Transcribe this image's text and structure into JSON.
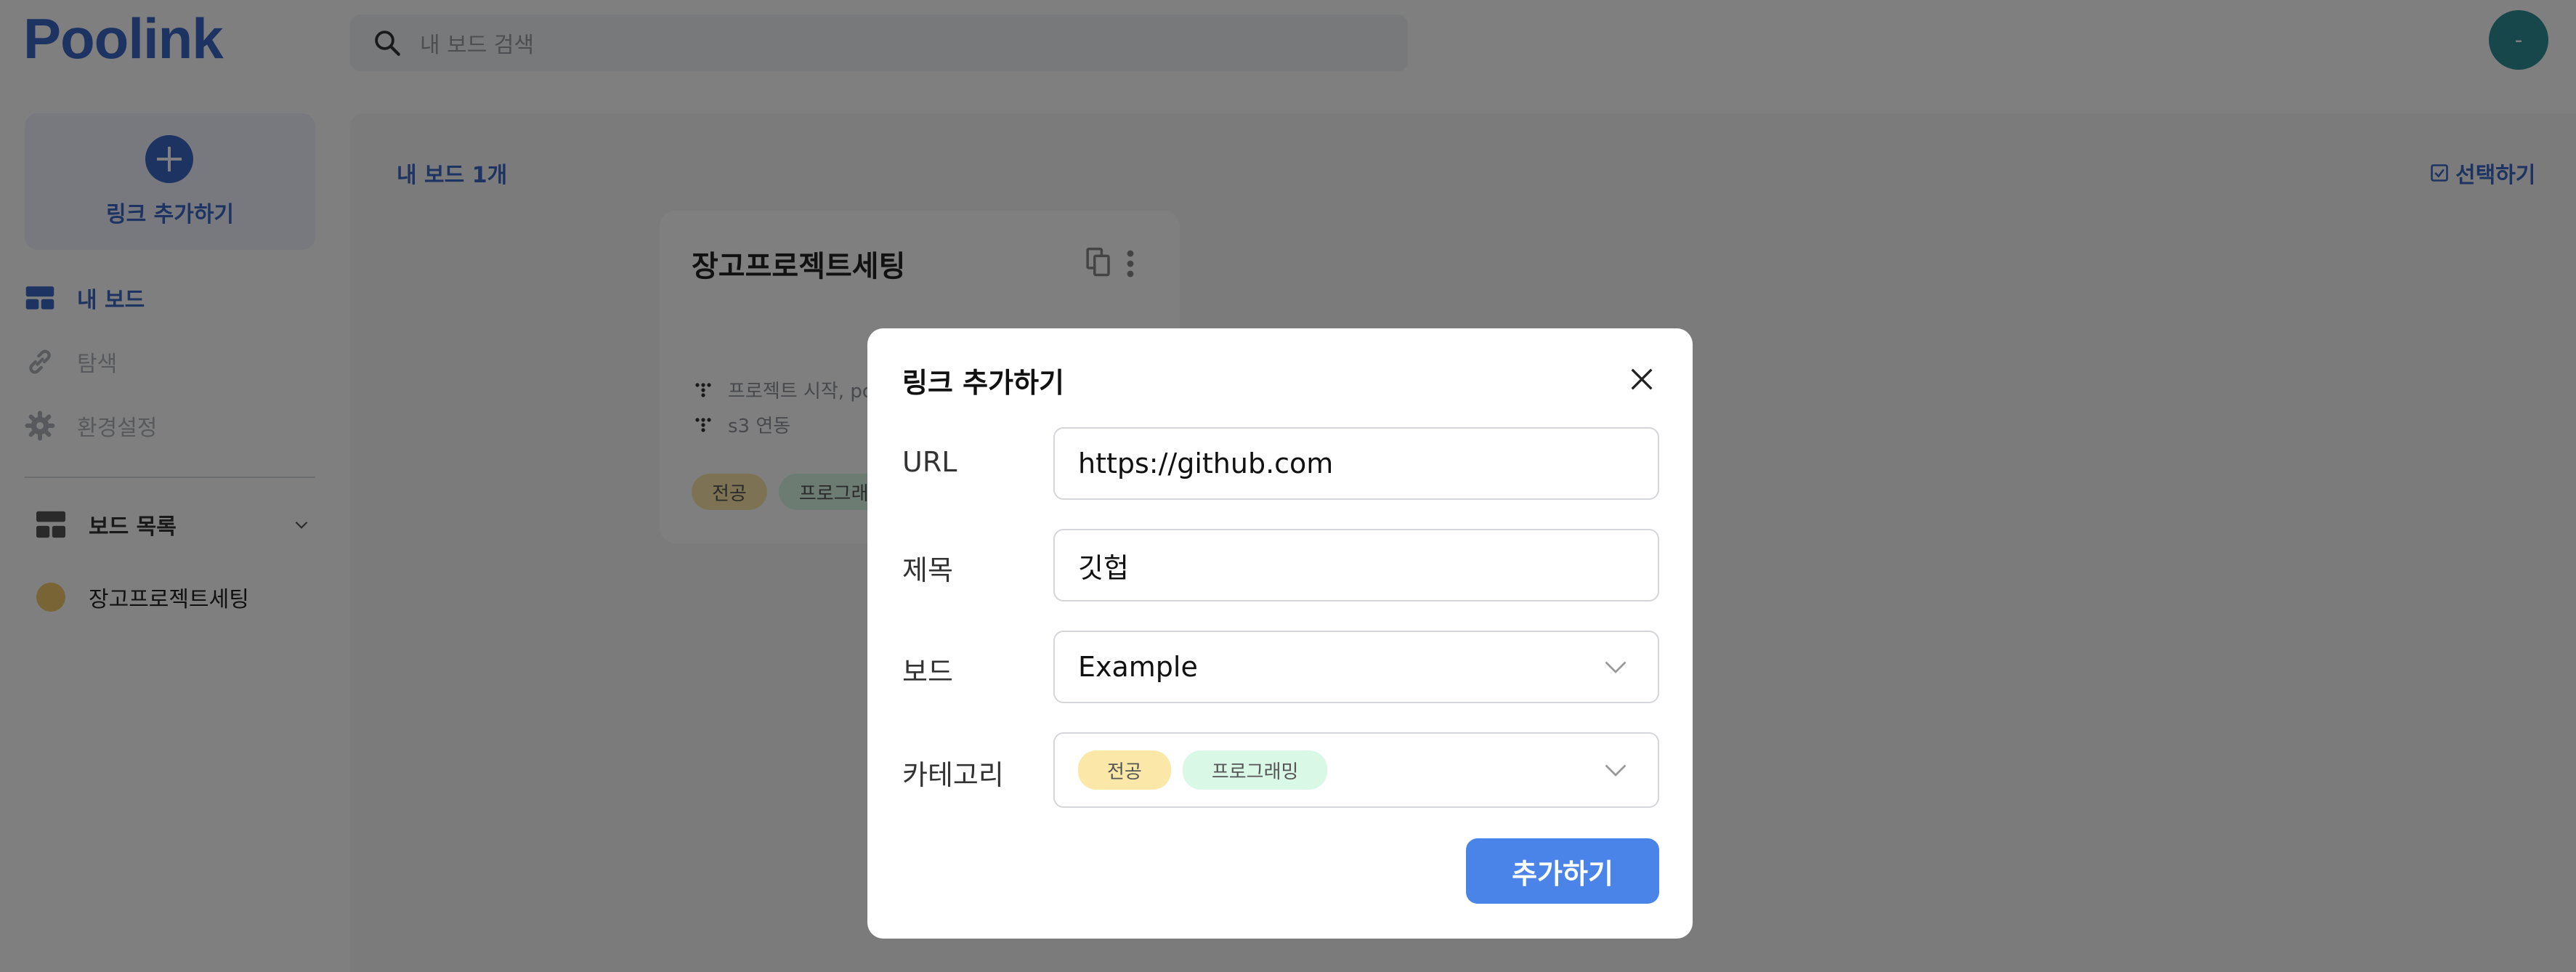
{
  "app": {
    "logo": "Poolink"
  },
  "header": {
    "search_placeholder": "내 보드 검색",
    "avatar_initial": "-"
  },
  "sidebar": {
    "add_link_label": "링크 추가하기",
    "nav": [
      {
        "label": "내 보드",
        "icon": "dashboard-icon",
        "active": true
      },
      {
        "label": "탐색",
        "icon": "link-icon",
        "active": false
      },
      {
        "label": "환경설정",
        "icon": "gear-icon",
        "active": false
      }
    ],
    "board_list_title": "보드 목록",
    "boards": [
      {
        "label": "장고프로젝트세팅",
        "color": "#f0c96a"
      }
    ]
  },
  "main": {
    "board_count": "내 보드 1개",
    "select_label": "선택하기",
    "card": {
      "title": "장고프로젝트세팅",
      "links": [
        "프로젝트 시작, po",
        "s3 연동"
      ],
      "tags": [
        {
          "label": "전공",
          "color": "#fbe7a8"
        },
        {
          "label": "프로그래밍",
          "color": "#d9f8e6"
        }
      ]
    }
  },
  "modal": {
    "title": "링크 추가하기",
    "fields": {
      "url": {
        "label": "URL",
        "value": "https://github.com"
      },
      "title": {
        "label": "제목",
        "value": "깃헙"
      },
      "board": {
        "label": "보드",
        "value": "Example"
      },
      "category": {
        "label": "카테고리",
        "tags": [
          "전공",
          "프로그래밍"
        ]
      }
    },
    "submit_label": "추가하기"
  },
  "colors": {
    "brand": "#3b66c4",
    "submit": "#4a84e8",
    "avatar": "#2e8f96"
  }
}
